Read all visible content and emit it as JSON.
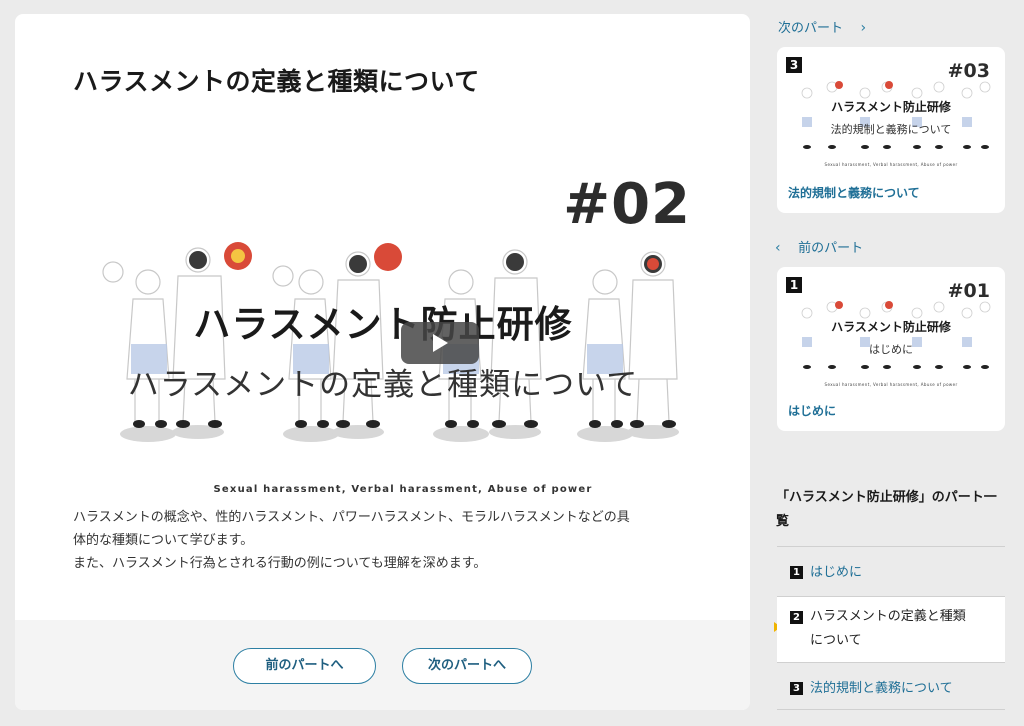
{
  "main": {
    "title": "ハラスメントの定義と種類について",
    "video": {
      "episode": "#02",
      "title": "ハラスメント防止研修",
      "subtitle": "ハラスメントの定義と種類について",
      "tagline": "Sexual harassment, Verbal harassment, Abuse of power",
      "play_icon": "play-icon"
    },
    "description": [
      "ハラスメントの概念や、性的ハラスメント、パワーハラスメント、モラルハラスメントなどの具",
      "体的な種類について学びます。",
      "また、ハラスメント行為とされる行動の例についても理解を深めます。"
    ],
    "buttons": {
      "prev": "前のパートへ",
      "next": "次のパートへ"
    }
  },
  "sidebar": {
    "next_link": "次のパート",
    "prev_link": "前のパート",
    "next_card": {
      "badge": "3",
      "episode": "#03",
      "title": "ハラスメント防止研修",
      "subtitle": "法的規制と義務について",
      "tagline": "Sexual harassment, Verbal harassment, Abuse of power",
      "label": "法的規制と義務について"
    },
    "prev_card": {
      "badge": "1",
      "episode": "#01",
      "title": "ハラスメント防止研修",
      "subtitle": "はじめに",
      "tagline": "Sexual harassment, Verbal harassment, Abuse of power",
      "label": "はじめに"
    },
    "list_heading_line1": "「ハラスメント防止研修」のパート一",
    "list_heading_line2": "覧",
    "list": [
      {
        "badge": "1",
        "label": "はじめに",
        "current": false
      },
      {
        "badge": "2",
        "label_line1": "ハラスメントの定義と種類",
        "label_line2": "について",
        "current": true
      },
      {
        "badge": "3",
        "label": "法的規制と義務について",
        "current": false
      }
    ]
  },
  "colors": {
    "accent": "#1f6f96",
    "active_marker": "#f0b400",
    "background": "#ebebeb"
  }
}
